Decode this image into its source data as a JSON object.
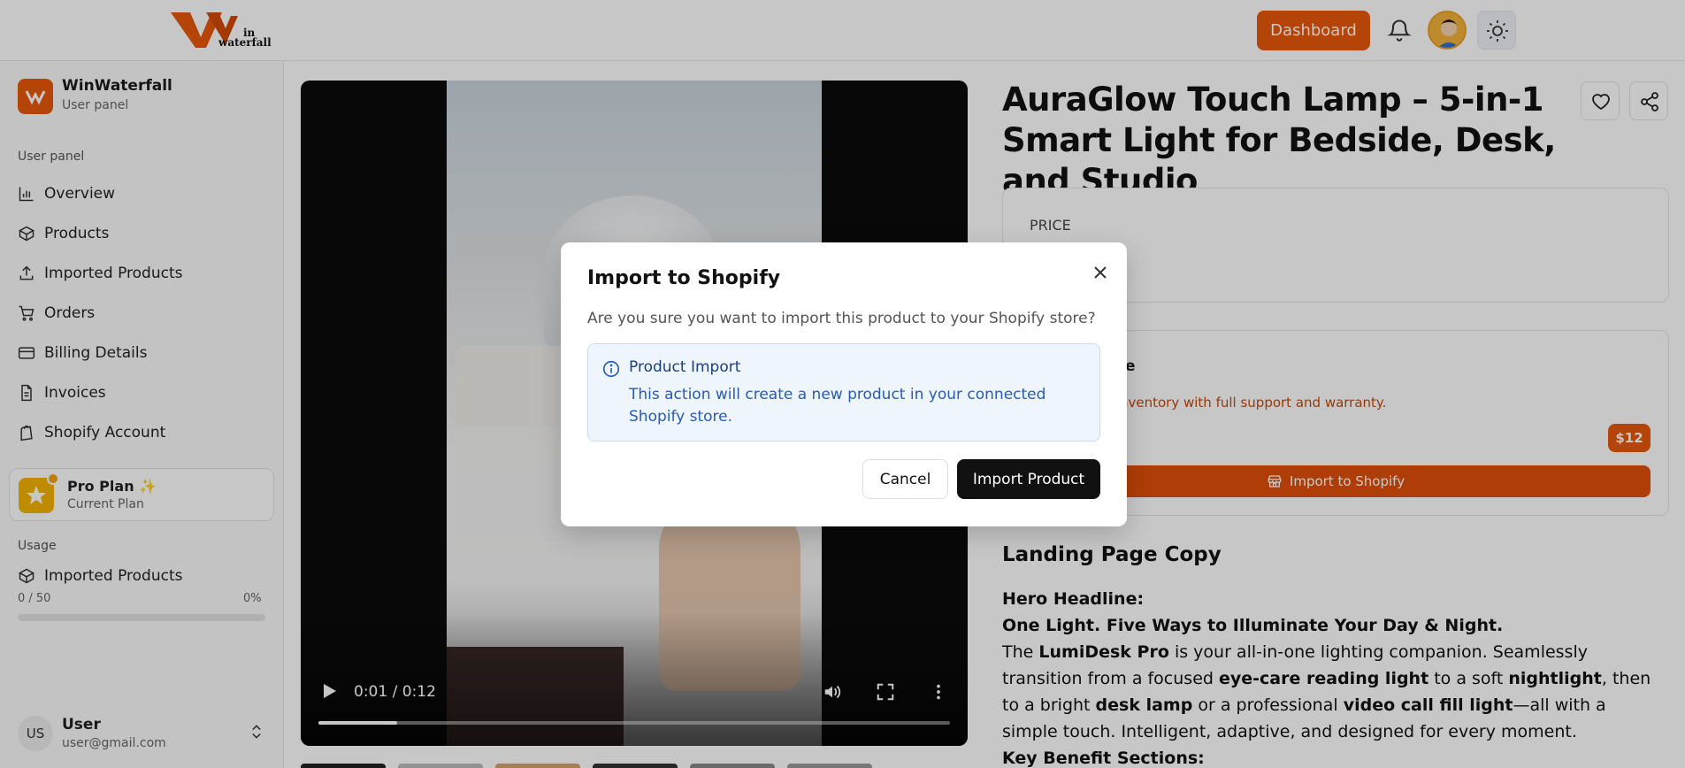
{
  "header": {
    "logo_text_top": "in",
    "logo_text_bottom": "waterfall",
    "dashboard_label": "Dashboard"
  },
  "sidebar": {
    "brand_name": "WinWaterfall",
    "brand_sub": "User panel",
    "section_label": "User panel",
    "items": [
      {
        "label": "Overview",
        "icon": "chart-bar-icon"
      },
      {
        "label": "Products",
        "icon": "box-icon"
      },
      {
        "label": "Imported Products",
        "icon": "upload-icon"
      },
      {
        "label": "Orders",
        "icon": "cart-icon"
      },
      {
        "label": "Billing Details",
        "icon": "credit-card-icon"
      },
      {
        "label": "Invoices",
        "icon": "file-icon"
      },
      {
        "label": "Shopify Account",
        "icon": "shopify-icon"
      }
    ],
    "plan": {
      "name": "Pro Plan",
      "sub": "Current Plan",
      "emoji": "✨"
    },
    "usage": {
      "label": "Usage",
      "item": "Imported Products",
      "count": "0 / 50",
      "percent": "0%",
      "fraction": 0
    },
    "user": {
      "initials": "US",
      "name": "User",
      "email": "user@gmail.com"
    }
  },
  "video": {
    "time": "0:01 / 0:12",
    "progress": 0.125
  },
  "product": {
    "title": "AuraGlow Touch Lamp – 5-in-1 Smart Light for Bedside, Desk, and Studio",
    "price_label": "PRICE",
    "import_title_visible": "e",
    "import_desc_visible": "nventory with full support and warranty.",
    "price_badge": "$12",
    "import_button": "Import to Shopify"
  },
  "landing": {
    "section_title": "Landing Page Copy",
    "hero_label": "Hero Headline:",
    "hero_headline": "One Light. Five Ways to Illuminate Your Day & Night.",
    "p1": "The ",
    "b1": "LumiDesk Pro",
    "p2": " is your all-in-one lighting companion. Seamlessly transition from a focused ",
    "b2": "eye-care reading light",
    "p3": " to a soft ",
    "b3": "nightlight",
    "p4": ", then to a bright ",
    "b4": "desk lamp",
    "p5": " or a professional ",
    "b5": "video call fill light",
    "p6": "—all with a simple touch. Intelligent, adaptive, and designed for every moment.",
    "benefits_label": "Key Benefit Sections:"
  },
  "modal": {
    "title": "Import to Shopify",
    "text": "Are you sure you want to import this product to your Shopify store?",
    "info_title": "Product Import",
    "info_desc": "This action will create a new product in your connected Shopify store.",
    "cancel": "Cancel",
    "confirm": "Import Product"
  },
  "colors": {
    "accent": "#e8580c",
    "info_bg": "#eef5fd",
    "info_text": "#2a5bb5"
  }
}
